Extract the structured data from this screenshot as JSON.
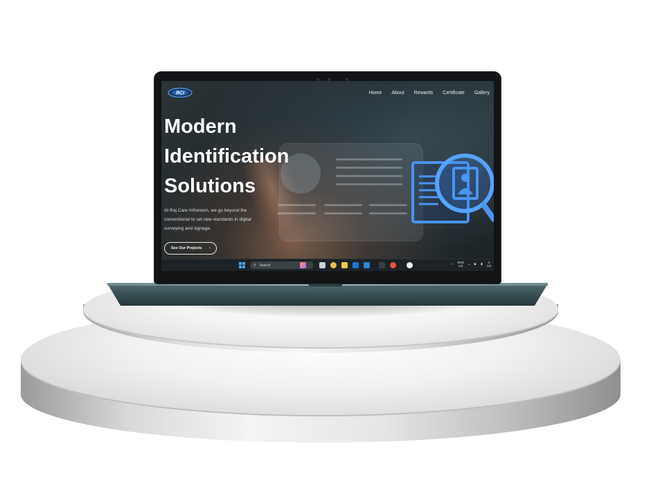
{
  "nav": {
    "items": [
      "Home",
      "About",
      "Rewards",
      "Certificate",
      "Gallery"
    ]
  },
  "logo": {
    "text": "RCI"
  },
  "hero": {
    "title": "Modern\nIdentification\nSolutions",
    "description": "At Raj Care Infovision, we go beyond the conventional to set new standards in digital surveying and signage.",
    "cta_label": "See Our Projects",
    "cta_icon": "chevron-right-icon"
  },
  "taskbar": {
    "search_placeholder": "Search",
    "language": "ENG",
    "region": "US",
    "clock_fragment_1": "4",
    "clock_fragment_2": "1/3"
  },
  "colors": {
    "accent_blue": "#3f8ef0",
    "hero_text": "#ffffff",
    "podium_light": "#f4f4f4",
    "laptop_base": "#3b5458"
  }
}
